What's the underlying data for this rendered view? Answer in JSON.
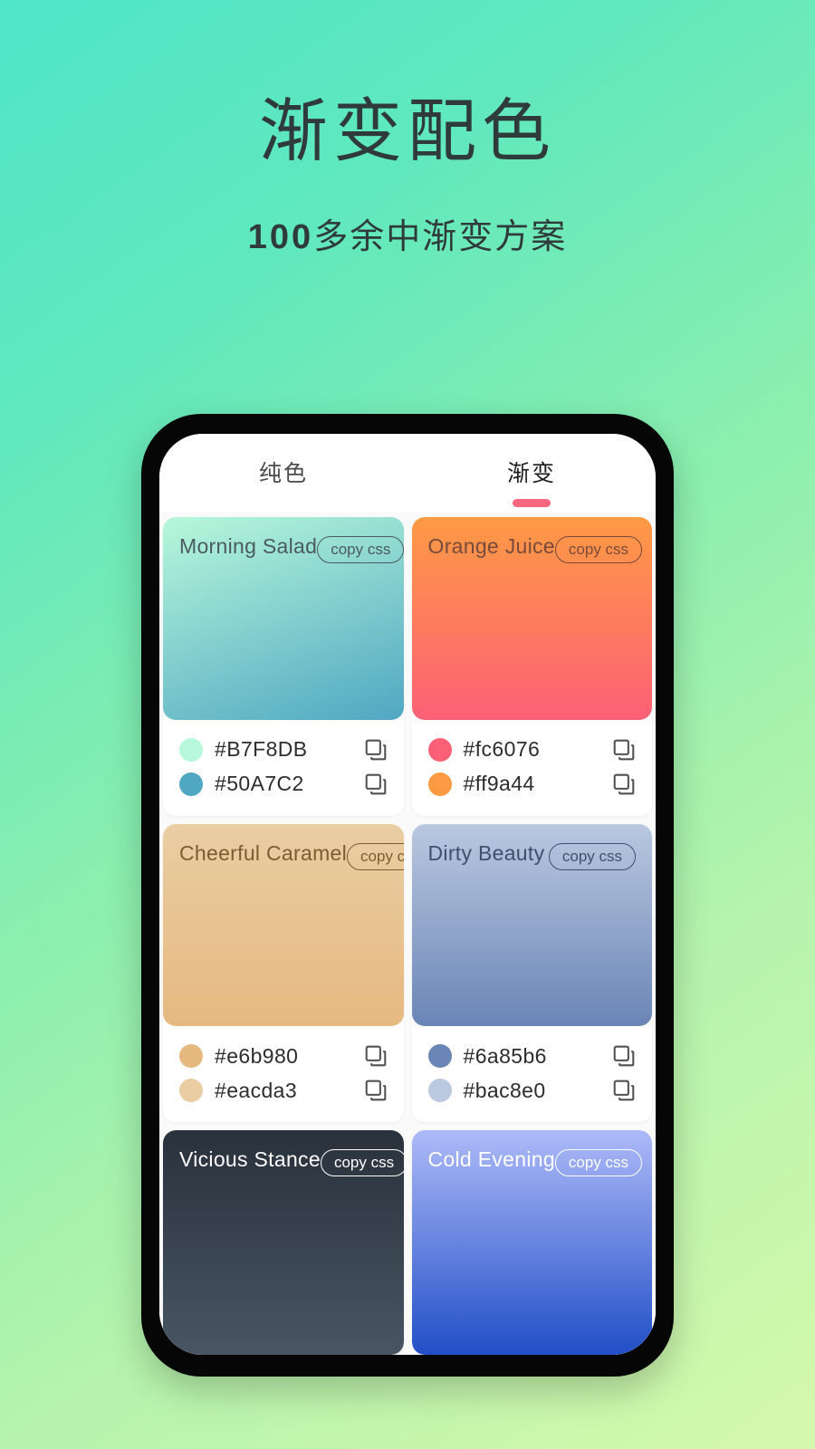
{
  "hero": {
    "title": "渐变配色",
    "subtitle_number": "100",
    "subtitle_rest": "多余中渐变方案"
  },
  "phone": {
    "tabs": [
      {
        "label": "纯色",
        "active": false
      },
      {
        "label": "渐变",
        "active": true
      }
    ],
    "active_tab_accent": "#f8677f"
  },
  "theme": {
    "page_gradient_start": "#4fe5c9",
    "page_gradient_end": "#d5f9ac",
    "screen_background": "#fafafa",
    "card_background": "#ffffff",
    "text_dark": "#2f3b3a"
  },
  "cards": [
    {
      "name": "Morning Salad",
      "copy_label": "copy css",
      "title_color": "#4b5a5f",
      "gradient_css": "linear-gradient(160deg, #B7F8DB 0%, #50A7C2 100%)",
      "colors": [
        {
          "hex": "#B7F8DB"
        },
        {
          "hex": "#50A7C2"
        }
      ]
    },
    {
      "name": "Orange Juice",
      "copy_label": "copy css",
      "title_color": "#7a4a3a",
      "gradient_css": "linear-gradient(180deg, #ff9a44 0%, #fc6076 100%)",
      "colors": [
        {
          "hex": "#fc6076"
        },
        {
          "hex": "#ff9a44"
        }
      ]
    },
    {
      "name": "Cheerful Caramel",
      "copy_label": "copy css",
      "title_color": "#7b5c33",
      "gradient_css": "linear-gradient(180deg, #eacda3 0%, #e6b980 100%)",
      "colors": [
        {
          "hex": "#e6b980"
        },
        {
          "hex": "#eacda3"
        }
      ]
    },
    {
      "name": "Dirty Beauty",
      "copy_label": "copy css",
      "title_color": "#3f4f6e",
      "gradient_css": "linear-gradient(180deg, #bac8e0 0%, #6a85b6 100%)",
      "colors": [
        {
          "hex": "#6a85b6"
        },
        {
          "hex": "#bac8e0"
        }
      ]
    },
    {
      "name": "Vicious Stance",
      "copy_label": "copy css",
      "title_color": "#ffffff",
      "gradient_css": "linear-gradient(180deg, #29323c 0%, #485563 100%)",
      "colors": []
    },
    {
      "name": "Cold Evening",
      "copy_label": "copy css",
      "title_color": "#ffffff",
      "gradient_css": "linear-gradient(180deg, #aebaf8 0%, #0c3fc0 115%)",
      "colors": []
    }
  ],
  "icons": {
    "copy": "copy-icon"
  }
}
